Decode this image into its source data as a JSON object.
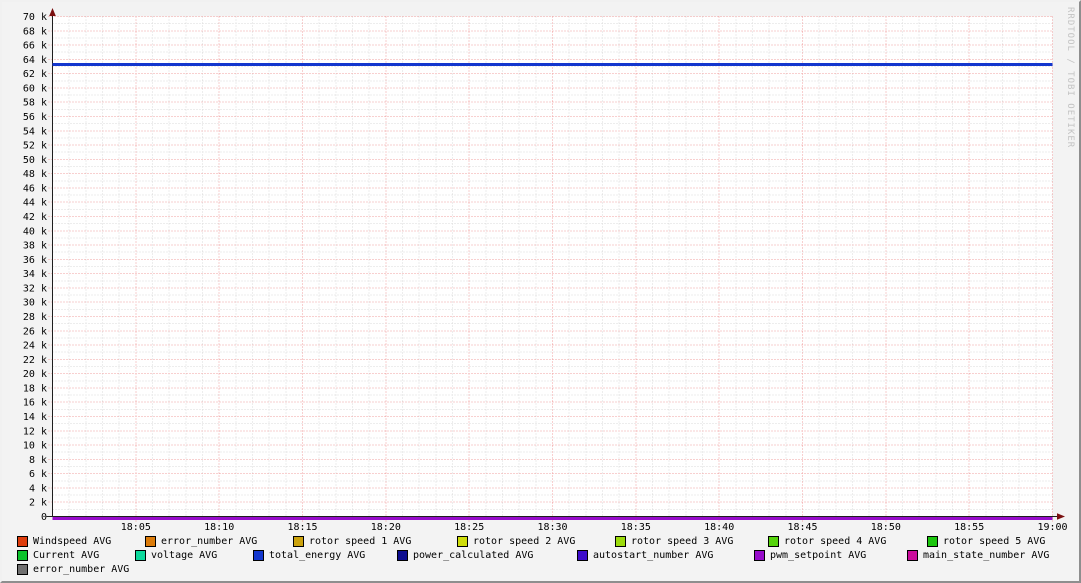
{
  "watermark": "RRDTOOL / TOBI OETIKER",
  "chart_data": {
    "type": "line",
    "title": "",
    "xlabel": "",
    "ylabel": "",
    "x_axis": {
      "window_minutes": 60,
      "major_tick_minutes": 5,
      "minor_tick_minutes": 1,
      "tick_labels": [
        "18:05",
        "18:10",
        "18:15",
        "18:20",
        "18:25",
        "18:30",
        "18:35",
        "18:40",
        "18:45",
        "18:50",
        "18:55",
        "19:00"
      ]
    },
    "y_axis": {
      "min": 0,
      "max": 70000,
      "major_step": 2000,
      "minor_step": 1000,
      "tick_labels": [
        "0",
        "2 k",
        "4 k",
        "6 k",
        "8 k",
        "10 k",
        "12 k",
        "14 k",
        "16 k",
        "18 k",
        "20 k",
        "22 k",
        "24 k",
        "26 k",
        "28 k",
        "30 k",
        "32 k",
        "34 k",
        "36 k",
        "38 k",
        "40 k",
        "42 k",
        "44 k",
        "46 k",
        "48 k",
        "50 k",
        "52 k",
        "54 k",
        "56 k",
        "58 k",
        "60 k",
        "62 k",
        "64 k",
        "66 k",
        "68 k",
        "70 k"
      ]
    },
    "style": {
      "canvas_color": "#ffffff",
      "background_color": "#f3f3f3",
      "major_grid_color": "#f0a0a0",
      "minor_grid_color": "#dbdbdb",
      "axis_color": "#1f1f1f",
      "arrow_color": "#7a1010",
      "text_color": "#000000"
    },
    "series": [
      {
        "name": "Windspeed AVG",
        "color": "#de3d0c",
        "value": 0
      },
      {
        "name": "error_number AVG",
        "color": "#dc7c0b",
        "value": 0
      },
      {
        "name": "rotor speed 1 AVG",
        "color": "#cba20c",
        "value": 0
      },
      {
        "name": "rotor speed 2 AVG",
        "color": "#cfdd0b",
        "value": 0
      },
      {
        "name": "rotor speed 3 AVG",
        "color": "#9cdb0c",
        "value": 0
      },
      {
        "name": "rotor speed 4 AVG",
        "color": "#55d30c",
        "value": 0
      },
      {
        "name": "rotor speed 5 AVG",
        "color": "#1cc60e",
        "value": 0
      },
      {
        "name": "Current AVG",
        "color": "#0cc32b",
        "value": 0
      },
      {
        "name": "voltage AVG",
        "color": "#0cd99c",
        "value": 0
      },
      {
        "name": "total_energy AVG",
        "color": "#1337ce",
        "value": 63300
      },
      {
        "name": "power_calculated AVG",
        "color": "#0d0d8f",
        "value": 0
      },
      {
        "name": "autostart_number AVG",
        "color": "#3d0ccb",
        "value": 0
      },
      {
        "name": "pwm_setpoint AVG",
        "color": "#970ccb",
        "value": 0
      },
      {
        "name": "main_state_number AVG",
        "color": "#cb0c9c",
        "value": null
      },
      {
        "name": "error_number AVG",
        "color": "#6f6f6f",
        "value": null
      }
    ],
    "legend_rows": [
      [
        0,
        1,
        2,
        3,
        4,
        5,
        6
      ],
      [
        7,
        8,
        9,
        10,
        11,
        12,
        13
      ],
      [
        14
      ]
    ]
  }
}
